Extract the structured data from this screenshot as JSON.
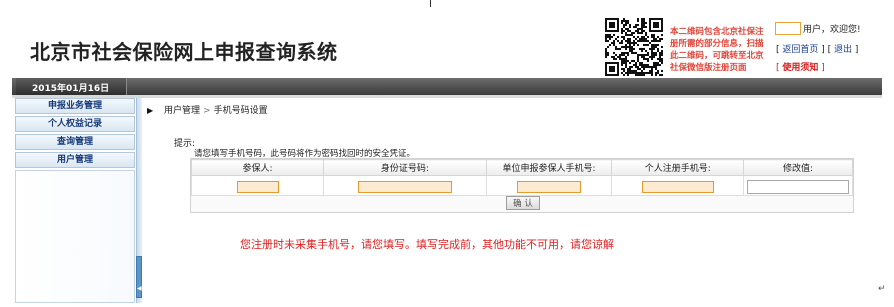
{
  "header": {
    "title": "北京市社会保险网上申报查询系统",
    "qr_notice": "本二维码包含北京社保注册所需的部分信息，扫描此二维码，可跳转至北京社保微信版注册页面",
    "welcome": "用户，欢迎您!",
    "links": {
      "home": "返回首页",
      "logout": "退出",
      "notice": "使用须知"
    }
  },
  "date_bar": {
    "date": "2015年01月16日"
  },
  "sidebar": {
    "items": [
      {
        "label": "申报业务管理"
      },
      {
        "label": "个人权益记录"
      },
      {
        "label": "查询管理"
      },
      {
        "label": "用户管理"
      }
    ]
  },
  "breadcrumb": {
    "parent": "用户管理",
    "current": "手机号码设置"
  },
  "tips": {
    "label": "提示:",
    "text": "请您填写手机号码，此号码将作为密码找回时的安全凭证。"
  },
  "form": {
    "columns": [
      "参保人:",
      "身份证号码:",
      "单位申报参保人手机号:",
      "个人注册手机号:",
      "修改值:"
    ],
    "values": {
      "insured": "",
      "id_number": "",
      "unit_phone": "",
      "personal_phone": "",
      "modify_value": ""
    },
    "confirm_label": "确 认"
  },
  "note": "您注册时未采集手机号，请您填写。填写完成前，其他功能不可用，请您谅解",
  "colors": {
    "accent_red": "#e02020",
    "nav_blue": "#14397a",
    "field_orange": "#e59a2f"
  }
}
